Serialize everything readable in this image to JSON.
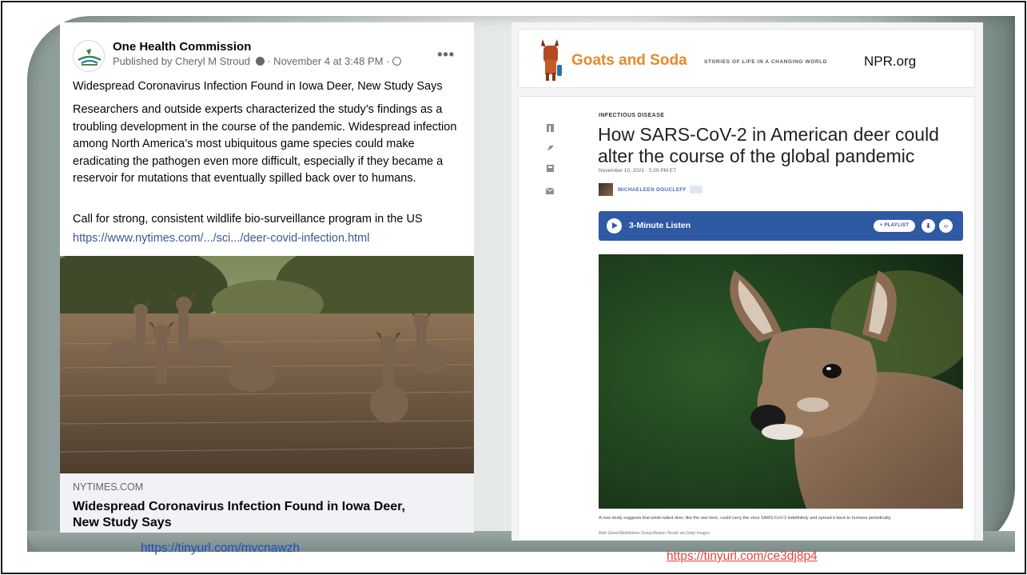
{
  "facebook_post": {
    "page_name": "One Health Commission",
    "meta": "Published by Cheryl M Stroud",
    "meta_time": " · November 4 at 3:48 PM · ",
    "more_icon": "more-horizontal-icon",
    "headline_text": "Widespread Coronavirus Infection Found in Iowa Deer, New Study Says",
    "body_text": "Researchers and outside experts characterized the study’s findings as a troubling development in the course of the pandemic. Widespread infection among North America’s most ubiquitous game species could make eradicating the pathogen even more difficult, especially if they became a reservoir for mutations that eventually spilled back over to humans.",
    "call_text": "Call for strong, consistent wildlife bio-surveillance program in the US",
    "link_text": "https://www.nytimes.com/.../sci.../deer-covid-infection.html",
    "preview_domain": "NYTIMES.COM",
    "preview_title": "Widespread Coronavirus Infection Found in Iowa Deer, New Study Says"
  },
  "left_source_url": "https://tinyurl.com/mvcnawzh",
  "npr": {
    "brand": "Goats and Soda",
    "tagline": "STORIES OF LIFE IN A CHANGING WORLD",
    "site_label": "NPR.org",
    "share_icons": [
      "facebook-icon",
      "twitter-icon",
      "flipboard-icon",
      "email-icon"
    ],
    "kicker": "INFECTIOUS DISEASE",
    "headline": "How SARS-CoV-2 in American deer could alter the course of the global pandemic",
    "date": "November 10, 2021 · 5:29 PM ET",
    "author": "MICHAELEEN DOUCLEFF",
    "player_label": "3-Minute Listen",
    "playlist_label": "+ PLAYLIST",
    "caption": "A new study suggests that white-tailed deer, like the one here, could carry the virus SARS-CoV-2 indefinitely and spread it back to humans periodically.",
    "credit": "Matt Stone/MediaNews Group/Boston Herald via Getty Images"
  },
  "right_source_url": "https://tinyurl.com/ce3dj8p4",
  "colors": {
    "facebook_link": "#385898",
    "npr_player": "#2f5aa3",
    "npr_brand": "#e48a2b",
    "left_url": "#1a4fc4",
    "right_url": "#e0463c"
  }
}
